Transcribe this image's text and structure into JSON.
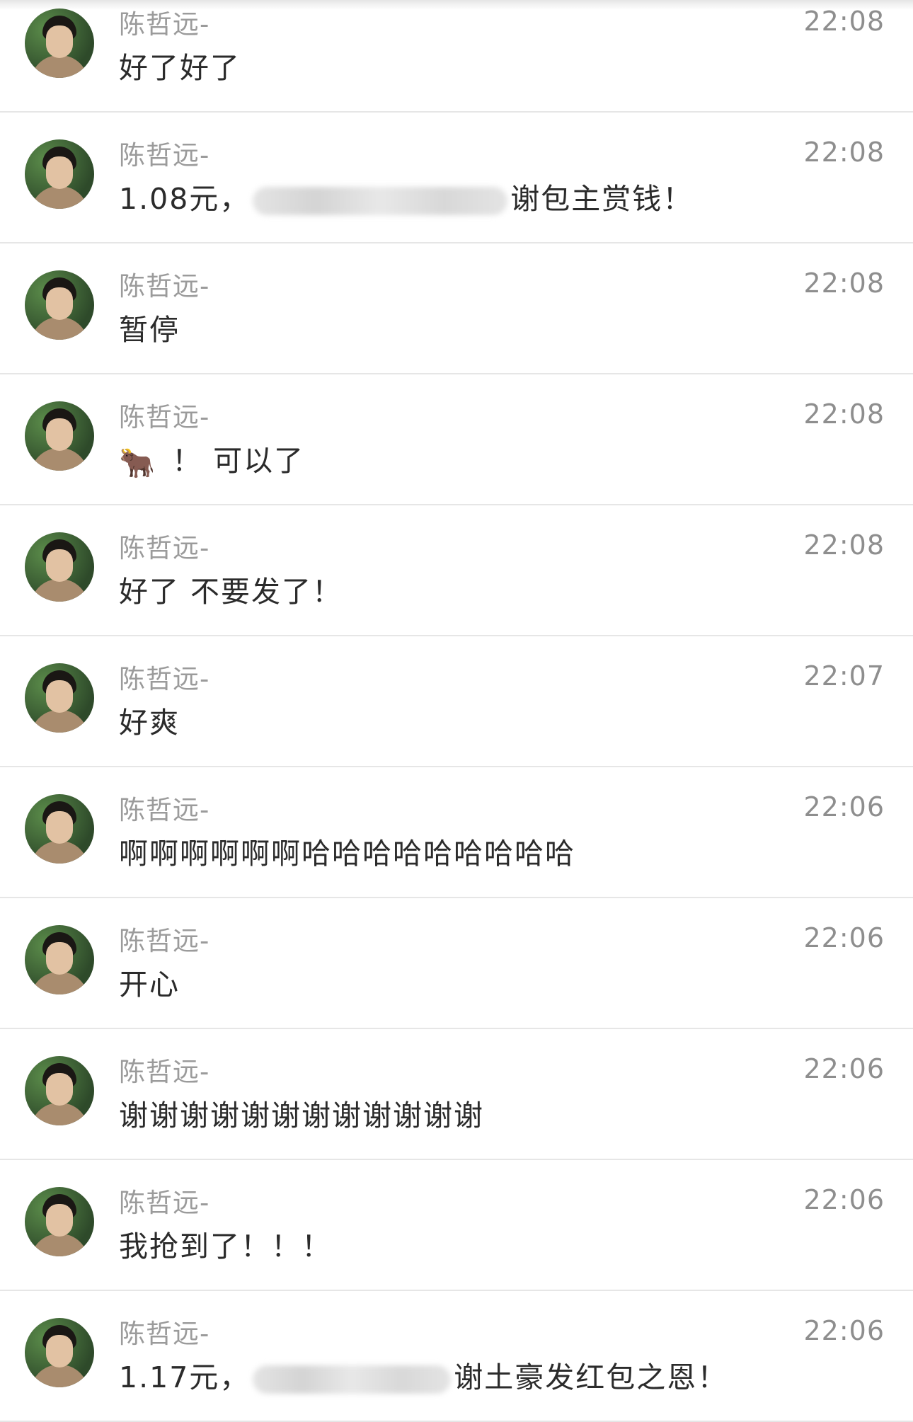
{
  "sender": "陈哲远-",
  "messages": [
    {
      "time": "22:08",
      "text": "好了好了"
    },
    {
      "time": "22:08",
      "prefix": "1.08元，",
      "suffix": "谢包主赏钱！"
    },
    {
      "time": "22:08",
      "text": "暂停"
    },
    {
      "time": "22:08",
      "emoji": "🐂",
      "text": "！ 可以了"
    },
    {
      "time": "22:08",
      "text": "好了 不要发了！"
    },
    {
      "time": "22:07",
      "text": "好爽"
    },
    {
      "time": "22:06",
      "text": "啊啊啊啊啊啊哈哈哈哈哈哈哈哈哈"
    },
    {
      "time": "22:06",
      "text": "开心"
    },
    {
      "time": "22:06",
      "text": "谢谢谢谢谢谢谢谢谢谢谢谢"
    },
    {
      "time": "22:06",
      "text": "我抢到了！！！"
    },
    {
      "time": "22:06",
      "prefix": "1.17元，",
      "suffix": "谢土豪发红包之恩！"
    }
  ]
}
